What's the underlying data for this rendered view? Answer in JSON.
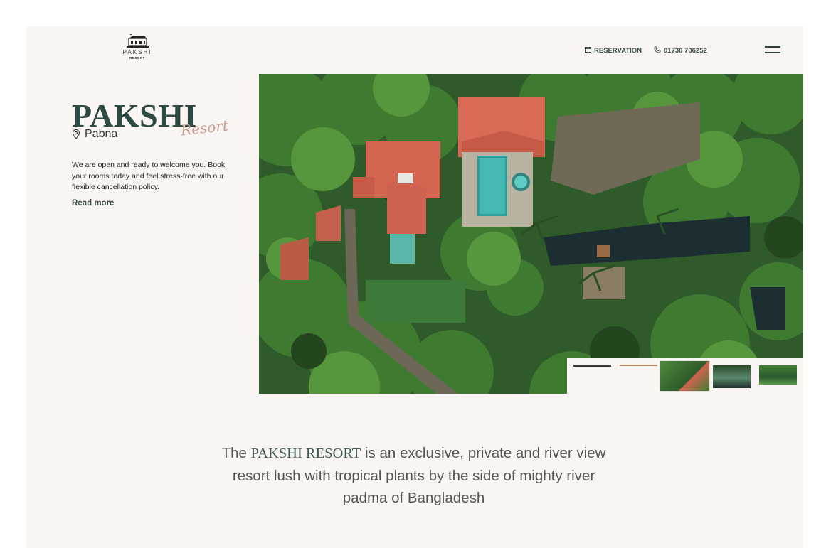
{
  "header": {
    "logo": {
      "name": "PAKSHI",
      "sub": "RESORT"
    },
    "reservation_label": "RESERVATION",
    "phone_label": "01730 706252"
  },
  "hero": {
    "title": "PAKSHI",
    "script_word": "Resort",
    "location": "Pabna",
    "description": "We are open and ready to welcome you. Book your rooms today and feel stress-free with our flexible cancellation policy.",
    "read_more": "Read more"
  },
  "intro": {
    "before": "The ",
    "brand": "PAKSHI RESORT",
    "after": " is an exclusive, private and river view resort lush with tropical plants by the side of mighty river padma of Bangladesh"
  },
  "icons": [
    "gift-icon",
    "phone-icon",
    "location-pin-icon",
    "hamburger-menu-icon"
  ],
  "colors": {
    "background": "#f8f5f2",
    "brand_green": "#2d4a42",
    "script_pink": "#c99a90"
  }
}
